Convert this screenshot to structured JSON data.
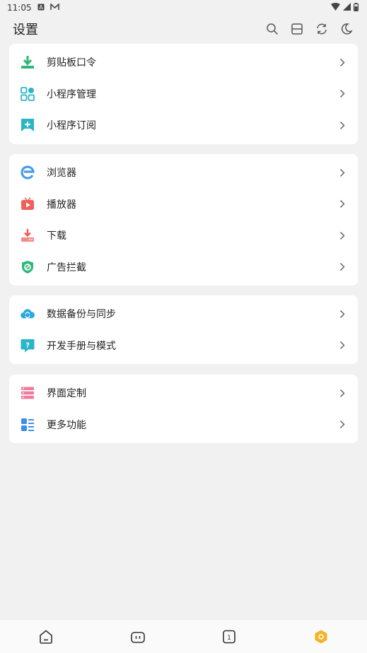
{
  "status_bar": {
    "time": "11:05",
    "notification_icons": [
      "a-box-icon",
      "m-mail-icon"
    ],
    "system_icons": [
      "wifi-icon",
      "signal-icon",
      "battery-icon"
    ]
  },
  "header": {
    "title": "设置",
    "actions": [
      "search-icon",
      "scan-icon",
      "refresh-icon",
      "moon-icon"
    ]
  },
  "groups": [
    {
      "items": [
        {
          "label": "剪贴板口令",
          "icon": "download-tray-icon",
          "color": "#2fb77b"
        },
        {
          "label": "小程序管理",
          "icon": "apps-grid-icon",
          "color": "#29b6c6"
        },
        {
          "label": "小程序订阅",
          "icon": "bookmark-plus-icon",
          "color": "#29b6c6"
        }
      ]
    },
    {
      "items": [
        {
          "label": "浏览器",
          "icon": "browser-e-icon",
          "color": "#4a9be8"
        },
        {
          "label": "播放器",
          "icon": "tv-play-icon",
          "color": "#f0605a"
        },
        {
          "label": "下载",
          "icon": "download-icon",
          "color": "#f0605a"
        },
        {
          "label": "广告拦截",
          "icon": "shield-block-icon",
          "color": "#2fb77b"
        }
      ]
    },
    {
      "items": [
        {
          "label": "数据备份与同步",
          "icon": "cloud-sync-icon",
          "color": "#29a9e0"
        },
        {
          "label": "开发手册与模式",
          "icon": "help-bubble-icon",
          "color": "#29b6c6"
        }
      ]
    },
    {
      "items": [
        {
          "label": "界面定制",
          "icon": "layout-bars-icon",
          "color": "#f27a9a"
        },
        {
          "label": "更多功能",
          "icon": "more-list-icon",
          "color": "#3f8de8"
        }
      ]
    }
  ],
  "bottom_nav": {
    "items": [
      "home-icon",
      "bilibili-tv-icon",
      "tabs-counter-icon",
      "settings-hex-icon"
    ],
    "tab_count": "1",
    "active_color": "#f5b324"
  }
}
